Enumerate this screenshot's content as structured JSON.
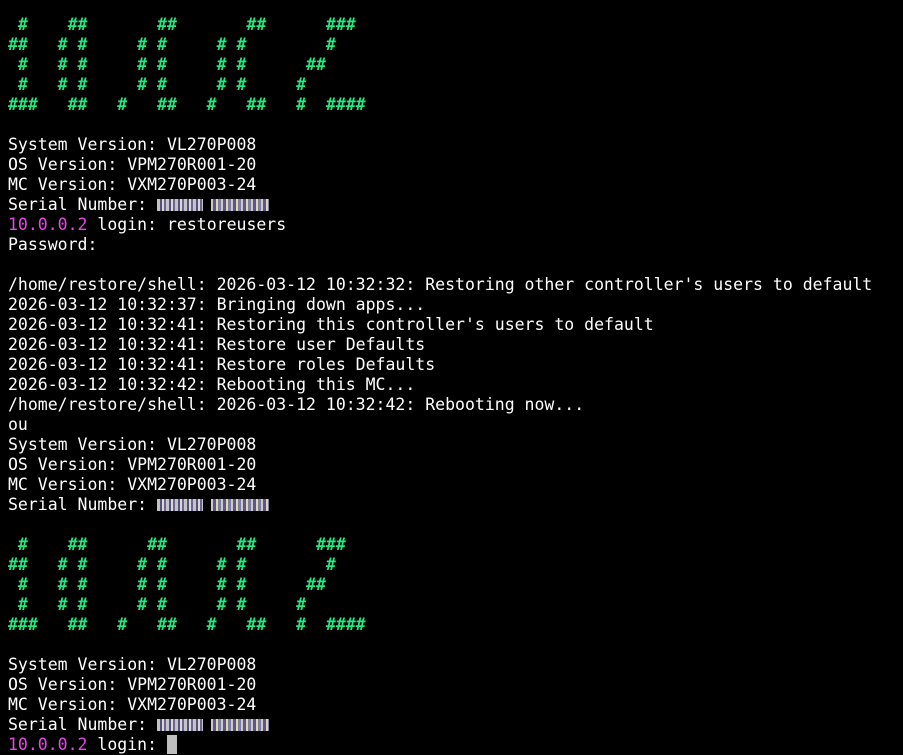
{
  "terminal": {
    "banner1": [
      " #    ##       ##       ##      ###",
      "##   # #     # #     # #        #",
      " #   # #     # #     # #      ##",
      " #   # #     # #     # #     #",
      "###   ##   #   ##   #   ##   #  ####"
    ],
    "info1": {
      "system": "System Version: VL270P008",
      "os": "OS Version: VPM270R001-20",
      "mc": "MC Version: VXM270P003-24",
      "serial_label": "Serial Number: "
    },
    "login1": {
      "host": "10.0.0.2",
      "prompt": " login: ",
      "user": "restoreusers"
    },
    "password_prompt": "Password:",
    "log_lines": [
      "/home/restore/shell: 2026-03-12 10:32:32: Restoring other controller's users to default",
      "2026-03-12 10:32:37: Bringing down apps...",
      "2026-03-12 10:32:41: Restoring this controller's users to default",
      "2026-03-12 10:32:41: Restore user Defaults",
      "2026-03-12 10:32:41: Restore roles Defaults",
      "2026-03-12 10:32:42: Rebooting this MC...",
      "/home/restore/shell: 2026-03-12 10:32:42: Rebooting now...",
      "ou"
    ],
    "info2": {
      "system": "System Version: VL270P008",
      "os": "OS Version: VPM270R001-20",
      "mc": "MC Version: VXM270P003-24",
      "serial_label": "Serial Number: "
    },
    "banner2": [
      " #    ##      ##       ##      ###",
      "##   # #     # #     # #        #",
      " #   # #     # #     # #      ##",
      " #   # #     # #     # #     #",
      "###   ##   #   ##   #   ##   #  ####"
    ],
    "info3": {
      "system": "System Version: VL270P008",
      "os": "OS Version: VPM270R001-20",
      "mc": "MC Version: VXM270P003-24",
      "serial_label": "Serial Number: "
    },
    "login2": {
      "host": "10.0.0.2",
      "prompt": " login: "
    },
    "colors": {
      "background": "#000000",
      "text": "#ffffff",
      "banner": "#27e67e",
      "host": "#e24ae2",
      "cursor": "#bfbfbf"
    }
  }
}
